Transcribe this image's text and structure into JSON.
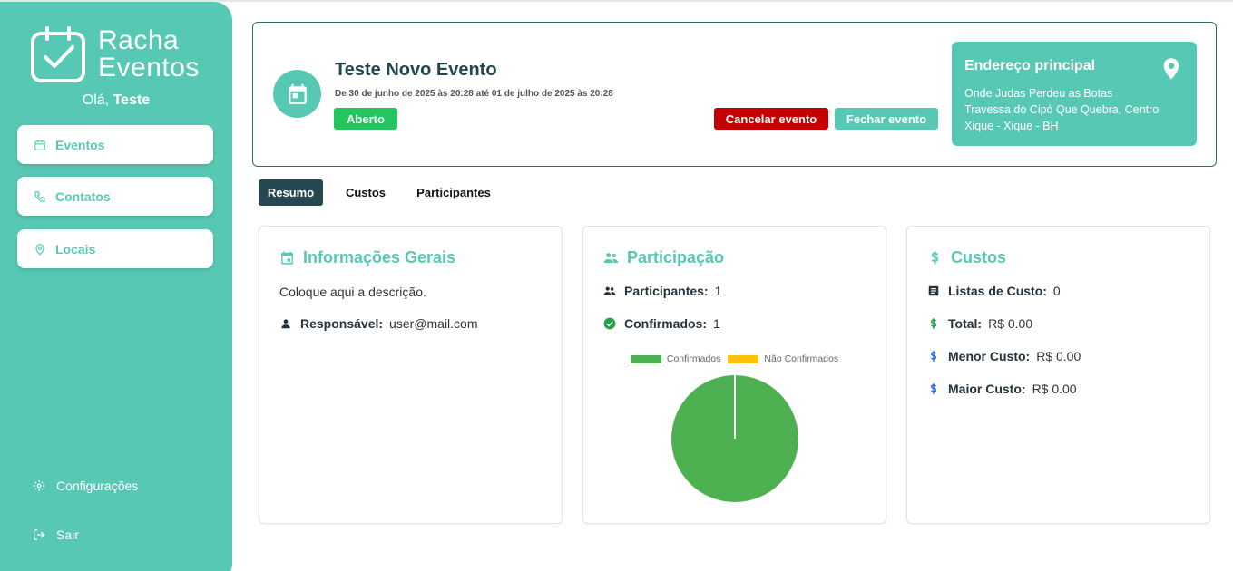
{
  "app": {
    "logo_line1": "Racha",
    "logo_line2": "Eventos",
    "greeting_prefix": "Olá,",
    "greeting_name": "Teste"
  },
  "sidebar": {
    "items": [
      {
        "label": "Eventos",
        "icon": "calendar-icon"
      },
      {
        "label": "Contatos",
        "icon": "phone-icon"
      },
      {
        "label": "Locais",
        "icon": "location-icon"
      }
    ],
    "settings_label": "Configurações",
    "logout_label": "Sair"
  },
  "event": {
    "title": "Teste Novo Evento",
    "dates": "De 30 de junho de 2025 às 20:28 até 01 de julho de 2025 às 20:28",
    "status": "Aberto",
    "cancel_label": "Cancelar evento",
    "close_label": "Fechar evento",
    "address": {
      "title": "Endereço principal",
      "line1": "Onde Judas Perdeu as Botas",
      "line2": "Travessa do Cipó Que Quebra, Centro",
      "line3": "Xique - Xique - BH"
    }
  },
  "tabs": [
    {
      "label": "Resumo",
      "active": true
    },
    {
      "label": "Custos",
      "active": false
    },
    {
      "label": "Participantes",
      "active": false
    }
  ],
  "info_card": {
    "title": "Informações Gerais",
    "description": "Coloque aqui a descrição.",
    "responsible_label": "Responsável:",
    "responsible_value": "user@mail.com"
  },
  "participation_card": {
    "title": "Participação",
    "participants_label": "Participantes:",
    "participants_value": "1",
    "confirmed_label": "Confirmados:",
    "confirmed_value": "1"
  },
  "costs_card": {
    "title": "Custos",
    "lists_label": "Listas de Custo:",
    "lists_value": "0",
    "total_label": "Total:",
    "total_value": "R$ 0.00",
    "min_label": "Menor Custo:",
    "min_value": "R$ 0.00",
    "max_label": "Maior Custo:",
    "max_value": "R$ 0.00"
  },
  "colors": {
    "accent": "#57c8b3",
    "dark": "#25474f",
    "danger": "#c40000",
    "success": "#22c55e",
    "confirmed": "#4caf50",
    "not_confirmed": "#ffc107"
  },
  "chart_data": {
    "type": "pie",
    "categories": [
      "Confirmados",
      "Não Confirmados"
    ],
    "values": [
      1,
      0
    ],
    "colors": [
      "#4caf50",
      "#ffc107"
    ],
    "legend": "top"
  }
}
